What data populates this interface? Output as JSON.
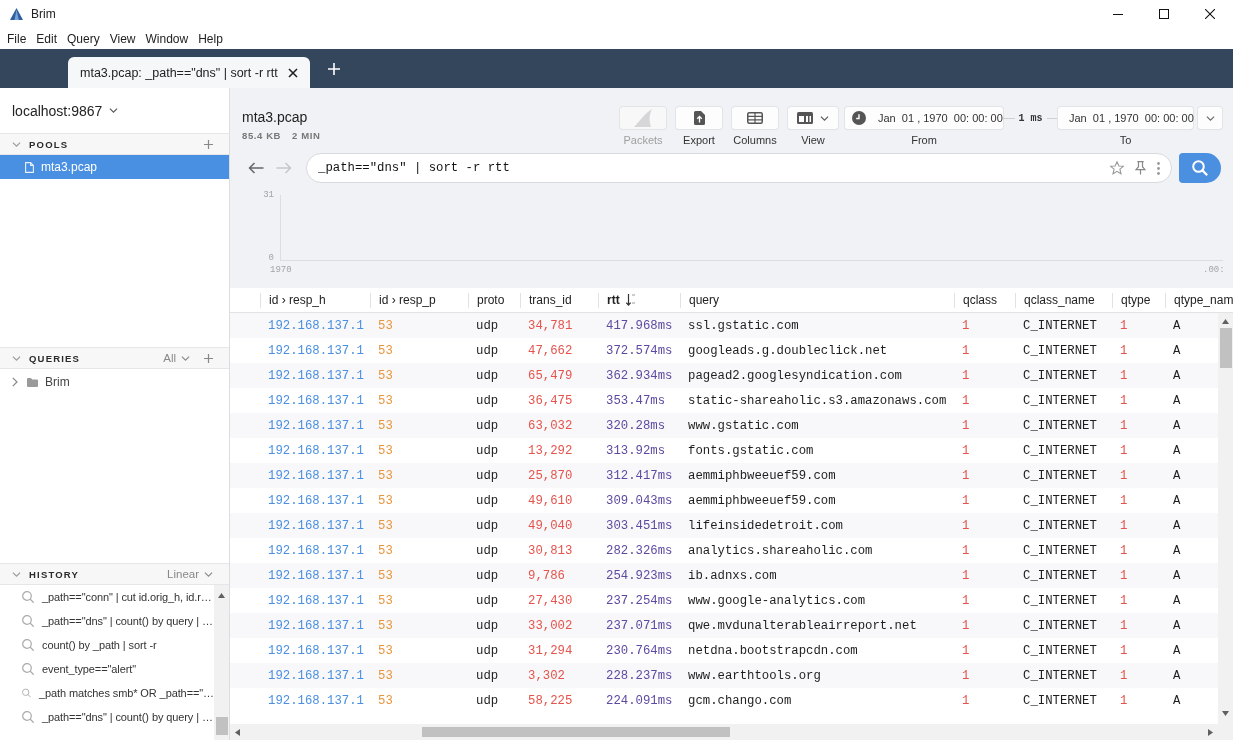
{
  "window": {
    "title": "Brim"
  },
  "menu": [
    "File",
    "Edit",
    "Query",
    "View",
    "Window",
    "Help"
  ],
  "tabs": [
    {
      "label": "mta3.pcap: _path==\"dns\" | sort -r rtt",
      "selected": true
    }
  ],
  "sidebar": {
    "host": "localhost:9867",
    "pools": {
      "title": "POOLS",
      "expanded": true,
      "items": [
        {
          "name": "mta3.pcap",
          "selected": true
        }
      ]
    },
    "queries": {
      "title": "QUERIES",
      "expanded": true,
      "filter": "All",
      "items": [
        {
          "name": "Brim",
          "expanded": false
        }
      ]
    },
    "history": {
      "title": "HISTORY",
      "expanded": true,
      "mode": "Linear",
      "items": [
        "_path==\"conn\" | cut id.orig_h, id.r…",
        "_path==\"dns\" | count() by query | …",
        "count() by _path | sort -r",
        "event_type==\"alert\"",
        "_path matches smb* OR _path==\"…",
        "_path==\"dns\" | count() by query | …"
      ]
    }
  },
  "pool": {
    "name": "mta3.pcap",
    "size": "85.4 KB",
    "duration": "2 MIN"
  },
  "toolbar": {
    "buttons": [
      {
        "kind": "packets",
        "label": "Packets",
        "disabled": true
      },
      {
        "kind": "export",
        "label": "Export",
        "disabled": false
      },
      {
        "kind": "columns",
        "label": "Columns",
        "disabled": false
      },
      {
        "kind": "view",
        "label": "View",
        "disabled": false
      }
    ],
    "from": {
      "label": "From",
      "value": "Jan  01 , 1970  00: 00: 00"
    },
    "span": "1 ms",
    "to": {
      "label": "To",
      "value": "Jan  01 , 1970  00: 00: 00"
    }
  },
  "navigation": [
    {
      "kind": "back",
      "disabled": false
    },
    {
      "kind": "forward",
      "disabled": true
    }
  ],
  "search": {
    "value": "_path==\"dns\" | sort -r rtt"
  },
  "histogram": {
    "y_ticks": [
      "31",
      "0"
    ],
    "x_ticks": [
      "1970",
      ".00:"
    ]
  },
  "table": {
    "columns": [
      {
        "label": "id › resp_h",
        "kind": "addr",
        "sorted": false
      },
      {
        "label": "id › resp_p",
        "kind": "port",
        "sorted": false
      },
      {
        "label": "proto",
        "kind": "enum",
        "sorted": false
      },
      {
        "label": "trans_id",
        "kind": "count",
        "sorted": false
      },
      {
        "label": "rtt",
        "kind": "interval",
        "sorted": true
      },
      {
        "label": "query",
        "kind": "string",
        "sorted": false
      },
      {
        "label": "qclass",
        "kind": "count",
        "sorted": false
      },
      {
        "label": "qclass_name",
        "kind": "string",
        "sorted": false
      },
      {
        "label": "qtype",
        "kind": "count",
        "sorted": false
      },
      {
        "label": "qtype_nam",
        "kind": "string",
        "sorted": false
      }
    ],
    "rows": [
      [
        "192.168.137.1",
        "53",
        "udp",
        "34,781",
        "417.968ms",
        "ssl.gstatic.com",
        "1",
        "C_INTERNET",
        "1",
        "A"
      ],
      [
        "192.168.137.1",
        "53",
        "udp",
        "47,662",
        "372.574ms",
        "googleads.g.doubleclick.net",
        "1",
        "C_INTERNET",
        "1",
        "A"
      ],
      [
        "192.168.137.1",
        "53",
        "udp",
        "65,479",
        "362.934ms",
        "pagead2.googlesyndication.com",
        "1",
        "C_INTERNET",
        "1",
        "A"
      ],
      [
        "192.168.137.1",
        "53",
        "udp",
        "36,475",
        "353.47ms",
        "static-shareaholic.s3.amazonaws.com",
        "1",
        "C_INTERNET",
        "1",
        "A"
      ],
      [
        "192.168.137.1",
        "53",
        "udp",
        "63,032",
        "320.28ms",
        "www.gstatic.com",
        "1",
        "C_INTERNET",
        "1",
        "A"
      ],
      [
        "192.168.137.1",
        "53",
        "udp",
        "13,292",
        "313.92ms",
        "fonts.gstatic.com",
        "1",
        "C_INTERNET",
        "1",
        "A"
      ],
      [
        "192.168.137.1",
        "53",
        "udp",
        "25,870",
        "312.417ms",
        "aemmiphbweeuef59.com",
        "1",
        "C_INTERNET",
        "1",
        "A"
      ],
      [
        "192.168.137.1",
        "53",
        "udp",
        "49,610",
        "309.043ms",
        "aemmiphbweeuef59.com",
        "1",
        "C_INTERNET",
        "1",
        "A"
      ],
      [
        "192.168.137.1",
        "53",
        "udp",
        "49,040",
        "303.451ms",
        "lifeinsidedetroit.com",
        "1",
        "C_INTERNET",
        "1",
        "A"
      ],
      [
        "192.168.137.1",
        "53",
        "udp",
        "30,813",
        "282.326ms",
        "analytics.shareaholic.com",
        "1",
        "C_INTERNET",
        "1",
        "A"
      ],
      [
        "192.168.137.1",
        "53",
        "udp",
        "9,786",
        "254.923ms",
        "ib.adnxs.com",
        "1",
        "C_INTERNET",
        "1",
        "A"
      ],
      [
        "192.168.137.1",
        "53",
        "udp",
        "27,430",
        "237.254ms",
        "www.google-analytics.com",
        "1",
        "C_INTERNET",
        "1",
        "A"
      ],
      [
        "192.168.137.1",
        "53",
        "udp",
        "33,002",
        "237.071ms",
        "qwe.mvdunalterableairreport.net",
        "1",
        "C_INTERNET",
        "1",
        "A"
      ],
      [
        "192.168.137.1",
        "53",
        "udp",
        "31,294",
        "230.764ms",
        "netdna.bootstrapcdn.com",
        "1",
        "C_INTERNET",
        "1",
        "A"
      ],
      [
        "192.168.137.1",
        "53",
        "udp",
        "3,302",
        "228.237ms",
        "www.earthtools.org",
        "1",
        "C_INTERNET",
        "1",
        "A"
      ],
      [
        "192.168.137.1",
        "53",
        "udp",
        "58,225",
        "224.091ms",
        "gcm.chango.com",
        "1",
        "C_INTERNET",
        "1",
        "A"
      ]
    ]
  }
}
